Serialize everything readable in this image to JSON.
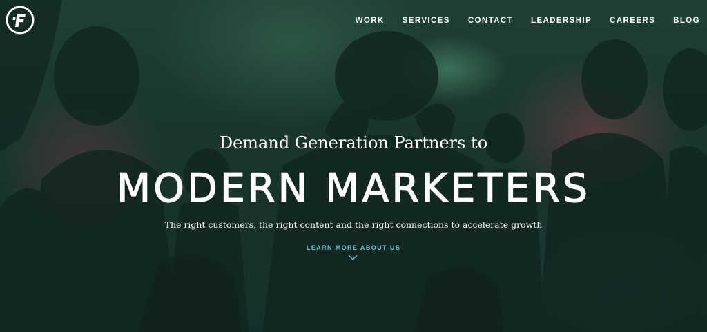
{
  "brand": {
    "logo_letter": "F",
    "accent_color": "#6fc3d6"
  },
  "nav": {
    "items": [
      {
        "label": "WORK"
      },
      {
        "label": "SERVICES"
      },
      {
        "label": "CONTACT"
      },
      {
        "label": "LEADERSHIP"
      },
      {
        "label": "CAREERS"
      },
      {
        "label": "BLOG"
      }
    ]
  },
  "hero": {
    "subtitle": "Demand Generation Partners to",
    "title": "MODERN MARKETERS",
    "tagline": "The right customers, the right content and the right connections to accelerate growth",
    "cta_label": "LEARN MORE ABOUT US",
    "cta_icon": "chevron-down-icon"
  }
}
